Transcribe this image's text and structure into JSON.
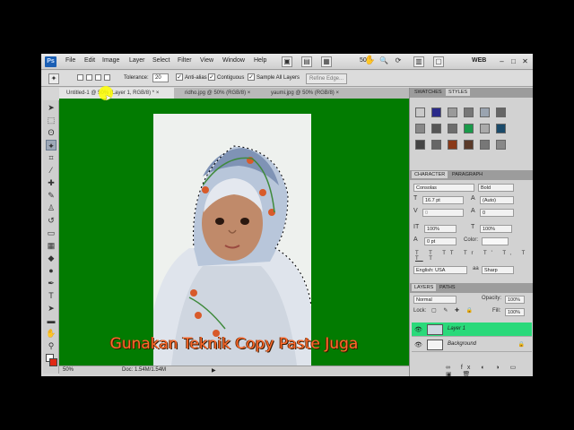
{
  "app": {
    "logo": "Ps",
    "workspace": "WEB",
    "zoom": "50%"
  },
  "menu": [
    "File",
    "Edit",
    "Image",
    "Layer",
    "Select",
    "Filter",
    "View",
    "Window",
    "Help"
  ],
  "options": {
    "tolerance_label": "Tolerance:",
    "tolerance_value": "20",
    "anti_alias": "Anti-alias",
    "contiguous": "Contiguous",
    "sample_all": "Sample All Layers",
    "refine_edge": "Refine Edge..."
  },
  "tabs": [
    {
      "label": "Untitled-1 @ 50% (Layer 1, RGB/8) *",
      "close": "×"
    },
    {
      "label": "ridho.jpg @ 50% (RGB/8)",
      "close": "×"
    },
    {
      "label": "yaumi.jpg @ 50% (RGB/8)",
      "close": "×"
    }
  ],
  "canvas": {
    "caption": "Gunakan Teknik Copy Paste Juga",
    "background_color": "#027b01"
  },
  "status": {
    "zoom": "50%",
    "doc": "Doc: 1.54M/1.54M"
  },
  "swatches_panel": {
    "tabs": [
      "SWATCHES",
      "STYLES"
    ]
  },
  "character_panel": {
    "tabs": [
      "CHARACTER",
      "PARAGRAPH"
    ],
    "font_family": "Consolas",
    "font_style": "Bold",
    "font_size": "16.7 pt",
    "leading": "(Auto)",
    "kerning": "0",
    "tracking": "0",
    "vertical_scale": "100%",
    "horizontal_scale": "100%",
    "baseline_shift": "0 pt",
    "color_label": "Color:",
    "language": "English: USA",
    "anti_alias": "Sharp"
  },
  "layers_panel": {
    "tabs": [
      "LAYERS",
      "PATHS"
    ],
    "blend_mode": "Normal",
    "opacity_label": "Opacity:",
    "opacity": "100%",
    "lock_label": "Lock:",
    "fill_label": "Fill:",
    "fill": "100%",
    "layers": [
      {
        "name": "Layer 1"
      },
      {
        "name": "Background"
      }
    ]
  }
}
